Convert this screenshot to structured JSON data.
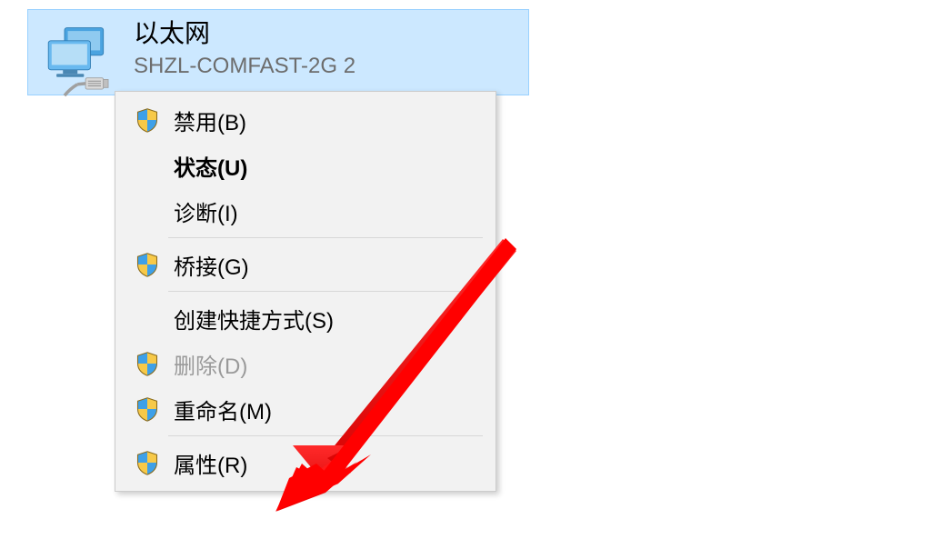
{
  "adapter": {
    "title": "以太网",
    "subtitle": "SHZL-COMFAST-2G 2"
  },
  "menu": {
    "items": [
      {
        "label": "禁用(B)",
        "hasShield": true,
        "bold": false,
        "disabled": false
      },
      {
        "label": "状态(U)",
        "hasShield": false,
        "bold": true,
        "disabled": false
      },
      {
        "label": "诊断(I)",
        "hasShield": false,
        "bold": false,
        "disabled": false
      },
      {
        "label": "桥接(G)",
        "hasShield": true,
        "bold": false,
        "disabled": false
      },
      {
        "label": "创建快捷方式(S)",
        "hasShield": false,
        "bold": false,
        "disabled": false
      },
      {
        "label": "删除(D)",
        "hasShield": true,
        "bold": false,
        "disabled": true
      },
      {
        "label": "重命名(M)",
        "hasShield": true,
        "bold": false,
        "disabled": false
      },
      {
        "label": "属性(R)",
        "hasShield": true,
        "bold": false,
        "disabled": false
      }
    ]
  },
  "colors": {
    "selection": "#cce8ff",
    "selectionBorder": "#99d1ff",
    "menuBg": "#f2f2f2",
    "menuBorder": "#cccccc",
    "disabledText": "#9a9a9a",
    "arrow": "#ff0000"
  }
}
